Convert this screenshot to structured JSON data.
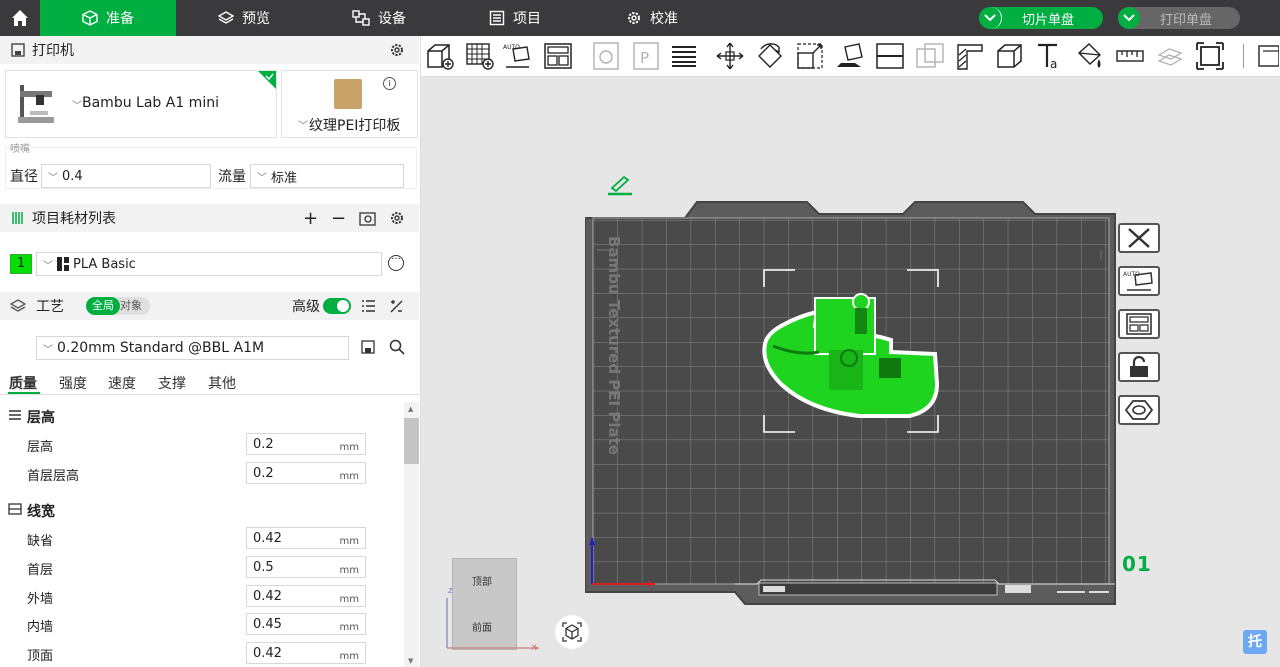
{
  "topbar": {
    "tabs": [
      {
        "label": "准备",
        "icon": "cube-icon"
      },
      {
        "label": "预览",
        "icon": "layers-icon"
      },
      {
        "label": "设备",
        "icon": "device-icon"
      },
      {
        "label": "项目",
        "icon": "list-icon"
      },
      {
        "label": "校准",
        "icon": "gear-icon"
      }
    ],
    "slice_label": "切片单盘",
    "print_label": "打印单盘",
    "accent": "#00ae42"
  },
  "printer": {
    "section_title": "打印机",
    "model": "Bambu Lab A1 mini",
    "plate": "纹理PEI打印板",
    "nozzle_caption": "喷嘴",
    "diameter_label": "直径",
    "diameter_value": "0.4",
    "flow_label": "流量",
    "flow_value": "标准"
  },
  "filament": {
    "section_title": "项目耗材列表",
    "slot_number": "1",
    "slot_color": "#00e000",
    "name": "PLA Basic"
  },
  "process": {
    "section_title": "工艺",
    "toggle_global": "全局",
    "toggle_object": "对象",
    "advanced_label": "高级",
    "preset": "0.20mm Standard @BBL A1M",
    "tabs": [
      "质量",
      "强度",
      "速度",
      "支撑",
      "其他"
    ],
    "groups": {
      "layer_height": {
        "title": "层高",
        "rows": [
          {
            "label": "层高",
            "value": "0.2",
            "unit": "mm"
          },
          {
            "label": "首层层高",
            "value": "0.2",
            "unit": "mm"
          }
        ]
      },
      "line_width": {
        "title": "线宽",
        "rows": [
          {
            "label": "缺省",
            "value": "0.42",
            "unit": "mm"
          },
          {
            "label": "首层",
            "value": "0.5",
            "unit": "mm"
          },
          {
            "label": "外墙",
            "value": "0.42",
            "unit": "mm"
          },
          {
            "label": "内墙",
            "value": "0.45",
            "unit": "mm"
          },
          {
            "label": "顶面",
            "value": "0.42",
            "unit": "mm"
          }
        ]
      }
    }
  },
  "viewport": {
    "plate_label": "Bambu Textured PEI Plate",
    "plate_number": "01",
    "view_cube_top": "顶部",
    "view_cube_front": "前面",
    "axis_x": "x",
    "axis_z": "z",
    "corner_badge": "托"
  }
}
